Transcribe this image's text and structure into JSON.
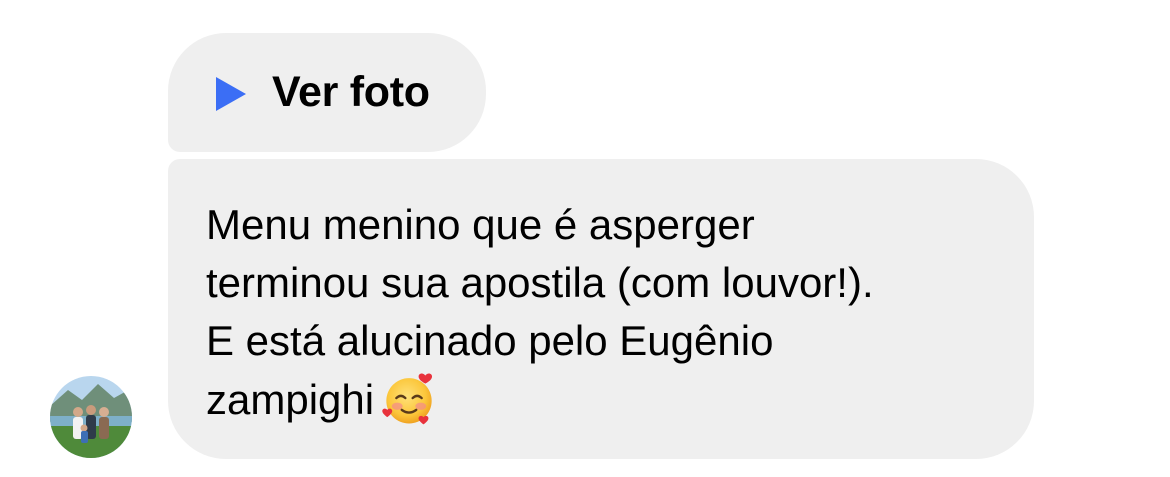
{
  "photo_message": {
    "label": "Ver foto",
    "icon": "play-icon",
    "accent_color": "#3b6ef5"
  },
  "text_message": {
    "lines": [
      "Menu menino que é asperger",
      "terminou sua apostila (com louvor!).",
      "E está alucinado pelo Eugênio",
      "zampighi"
    ],
    "emoji": "smiling-face-with-hearts-icon"
  },
  "sender": {
    "avatar": "avatar-photo"
  },
  "colors": {
    "bubble_background": "#efefef",
    "page_background": "#ffffff",
    "text": "#000000"
  }
}
